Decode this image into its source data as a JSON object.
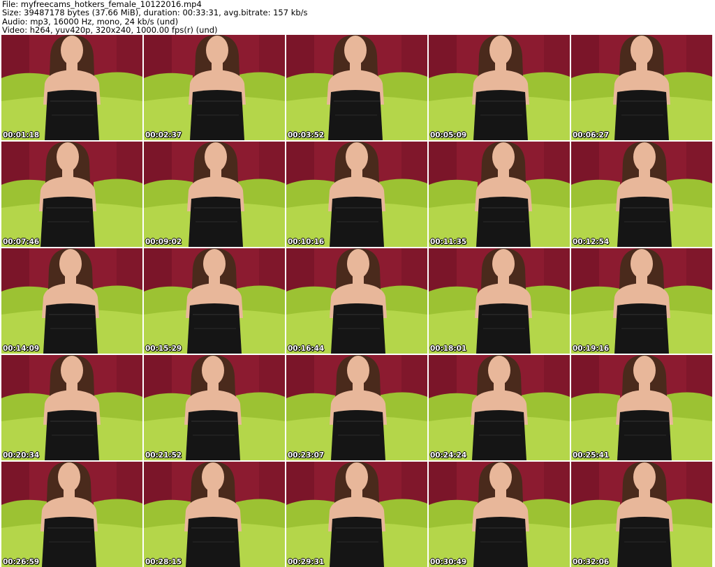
{
  "header": {
    "file": "File: myfreecams_hotkers_female_10122016.mp4",
    "size": "Size: 39487178 bytes (37.66 MiB), duration: 00:33:31, avg.bitrate: 157 kb/s",
    "audio": "Audio: mp3, 16000 Hz, mono, 24 kb/s (und)",
    "video": "Video: h264, yuv420p, 320x240, 1000.00 fps(r) (und)"
  },
  "colors": {
    "wall": "#8c1b30",
    "wall_dark": "#6a1022",
    "couch": "#9cc233",
    "couch_light": "#b4d64a",
    "skin": "#e8b79a",
    "hair": "#4a2a1c",
    "dress": "#151515"
  },
  "thumbnails": [
    {
      "timestamp": "00:01:18"
    },
    {
      "timestamp": "00:02:37"
    },
    {
      "timestamp": "00:03:52"
    },
    {
      "timestamp": "00:05:09"
    },
    {
      "timestamp": "00:06:27"
    },
    {
      "timestamp": "00:07:46"
    },
    {
      "timestamp": "00:09:02"
    },
    {
      "timestamp": "00:10:16"
    },
    {
      "timestamp": "00:11:35"
    },
    {
      "timestamp": "00:12:54"
    },
    {
      "timestamp": "00:14:09"
    },
    {
      "timestamp": "00:15:29"
    },
    {
      "timestamp": "00:16:44"
    },
    {
      "timestamp": "00:18:01"
    },
    {
      "timestamp": "00:19:16"
    },
    {
      "timestamp": "00:20:34"
    },
    {
      "timestamp": "00:21:52"
    },
    {
      "timestamp": "00:23:07"
    },
    {
      "timestamp": "00:24:24"
    },
    {
      "timestamp": "00:25:41"
    },
    {
      "timestamp": "00:26:59"
    },
    {
      "timestamp": "00:28:15"
    },
    {
      "timestamp": "00:29:31"
    },
    {
      "timestamp": "00:30:49"
    },
    {
      "timestamp": "00:32:06"
    }
  ]
}
